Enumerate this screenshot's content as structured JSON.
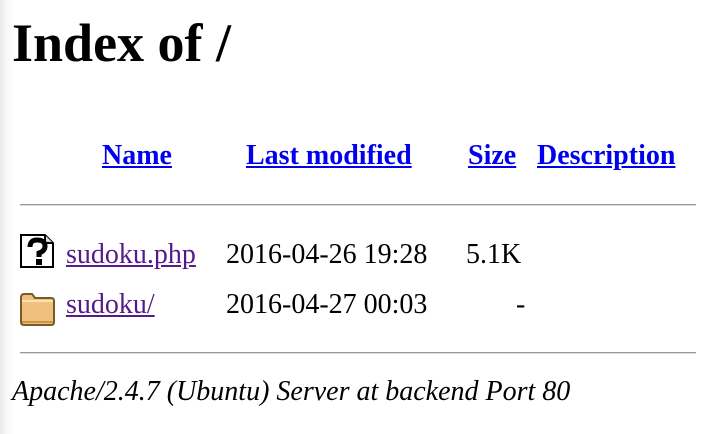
{
  "page": {
    "title": "Index of /",
    "footer": "Apache/2.4.7 (Ubuntu) Server at backend Port 80"
  },
  "columns": {
    "name": "Name",
    "last_modified": "Last modified",
    "size": "Size",
    "description": "Description"
  },
  "entries": [
    {
      "icon": "unknown-file-icon",
      "name": "sudoku.php",
      "last_modified": "2016-04-26 19:28",
      "size": "5.1K",
      "description": ""
    },
    {
      "icon": "folder-icon",
      "name": "sudoku/",
      "last_modified": "2016-04-27 00:03",
      "size": "-",
      "description": ""
    }
  ],
  "colors": {
    "link": "#0000ee",
    "visited_link": "#551a8b",
    "folder": "#f0c080"
  }
}
